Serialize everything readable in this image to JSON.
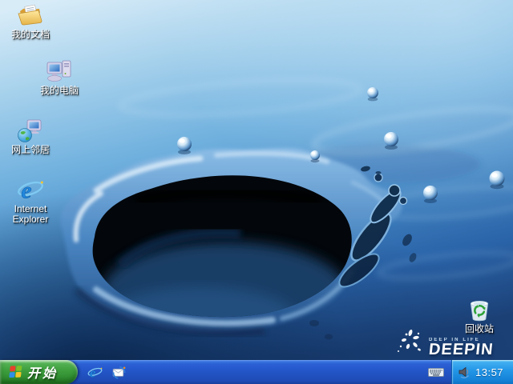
{
  "desktop": {
    "icons": [
      {
        "name": "my-documents",
        "label": "我的文档"
      },
      {
        "name": "my-computer",
        "label": "我的电脑"
      },
      {
        "name": "network-places",
        "label": "网上邻居"
      },
      {
        "name": "internet-explorer",
        "label": "Internet Explorer"
      },
      {
        "name": "recycle-bin",
        "label": "回收站"
      }
    ],
    "branding": {
      "tagline": "DEEP IN LIFE",
      "name": "DEEPIN"
    },
    "wallpaper_theme": "blue water drop splash"
  },
  "taskbar": {
    "start": {
      "label": "开始"
    },
    "quick_launch": [
      {
        "name": "internet-explorer"
      },
      {
        "name": "outlook-express"
      }
    ],
    "tray": {
      "clock": "13:57"
    }
  },
  "colors": {
    "taskbar_blue": "#2456c9",
    "taskbar_blue_dark": "#173f9e",
    "start_green": "#3d9e3d",
    "tray_blue": "#2598e8",
    "wallpaper_top": "#d8ecf8",
    "wallpaper_bottom": "#1b4076",
    "label_text": "#ffffff"
  }
}
